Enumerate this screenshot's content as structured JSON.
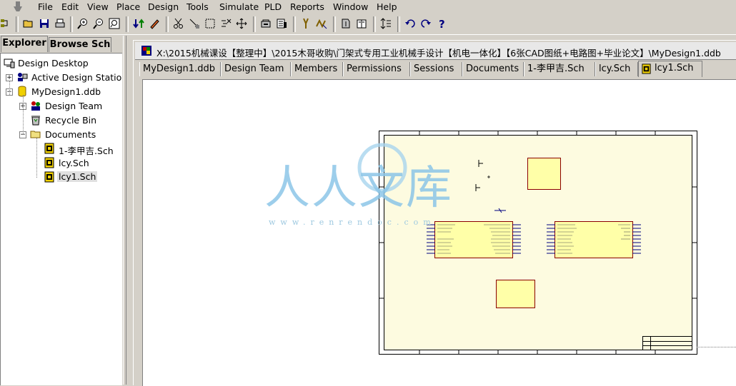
{
  "menu": [
    "File",
    "Edit",
    "View",
    "Place",
    "Design",
    "Tools",
    "Simulate",
    "PLD",
    "Reports",
    "Window",
    "Help"
  ],
  "left_panel": {
    "tabs": [
      "Explorer",
      "Browse Sch"
    ],
    "tree": {
      "root": "Design Desktop",
      "active_station": "Active Design Stations",
      "ddb": "MyDesign1.ddb",
      "design_team": "Design Team",
      "recycle_bin": "Recycle Bin",
      "documents": "Documents",
      "files": [
        "1-李甲吉.Sch",
        "lcy.Sch",
        "lcy1.Sch"
      ]
    }
  },
  "document": {
    "title": "X:\\2015机械课设【整理中】\\2015木哥收购\\门架式专用工业机械手设计【机电一体化】【6张CAD图纸+电路图+毕业论文】\\MyDesign1.ddb",
    "tabs": [
      "MyDesign1.ddb",
      "Design Team",
      "Members",
      "Permissions",
      "Sessions",
      "Documents",
      "1-李甲吉.Sch",
      "lcy.Sch",
      "lcy1.Sch"
    ],
    "active_tab": "lcy1.Sch"
  },
  "watermark": {
    "logo": "人人文库",
    "url": "www.renrendoc.com"
  },
  "colors": {
    "window_bg": "#d4d0c8",
    "sheet_bg": "#fdfbe0",
    "component_fill": "#ffffa8",
    "component_border": "#8b0000",
    "pin_color": "#000080"
  }
}
